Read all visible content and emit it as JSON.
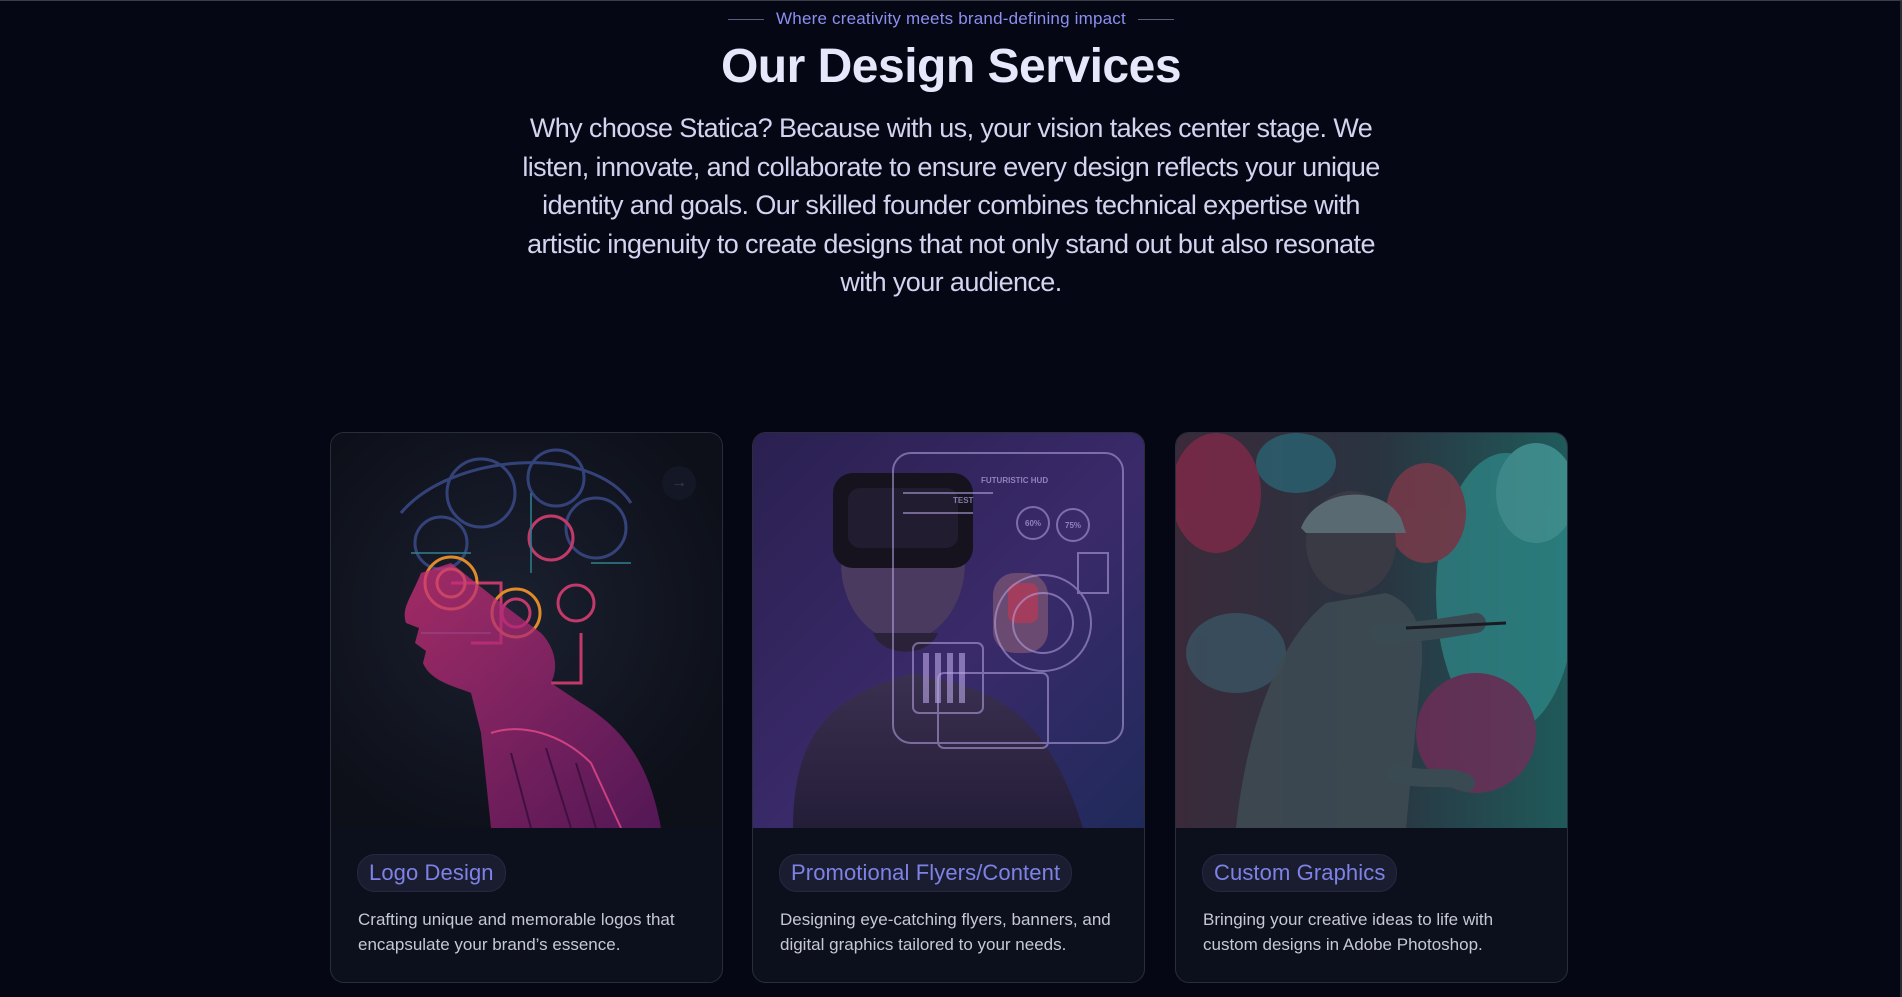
{
  "header": {
    "eyebrow": "Where creativity meets brand-defining impact",
    "title": "Our Design Services",
    "lead": "Why choose Statica? Because with us, your vision takes center stage. We listen, innovate, and collaborate to ensure every design reflects your unique identity and goals. Our skilled founder combines technical expertise with artistic ingenuity to create designs that not only stand out but also resonate with your audience."
  },
  "cards": [
    {
      "title": "Logo Design",
      "description": "Crafting unique and memorable logos that encapsulate your brand’s essence.",
      "image": "circuit-brain-portrait",
      "arrow_icon": "arrow-right-icon"
    },
    {
      "title": "Promotional Flyers/Content",
      "description": "Designing eye-catching flyers, banners, and digital graphics tailored to your needs.",
      "image": "vr-headset-interface",
      "hud_labels": [
        "FUTURISTIC HUD",
        "TEST",
        "60%",
        "75%"
      ]
    },
    {
      "title": "Custom Graphics",
      "description": "Bringing your creative ideas to life with custom designs in Adobe Photoshop.",
      "image": "artist-painting-wall"
    }
  ],
  "colors": {
    "background": "#050714",
    "accent": "#8b8ff0",
    "title": "#e6e7fb",
    "card_bg": "#0c0f1c"
  }
}
